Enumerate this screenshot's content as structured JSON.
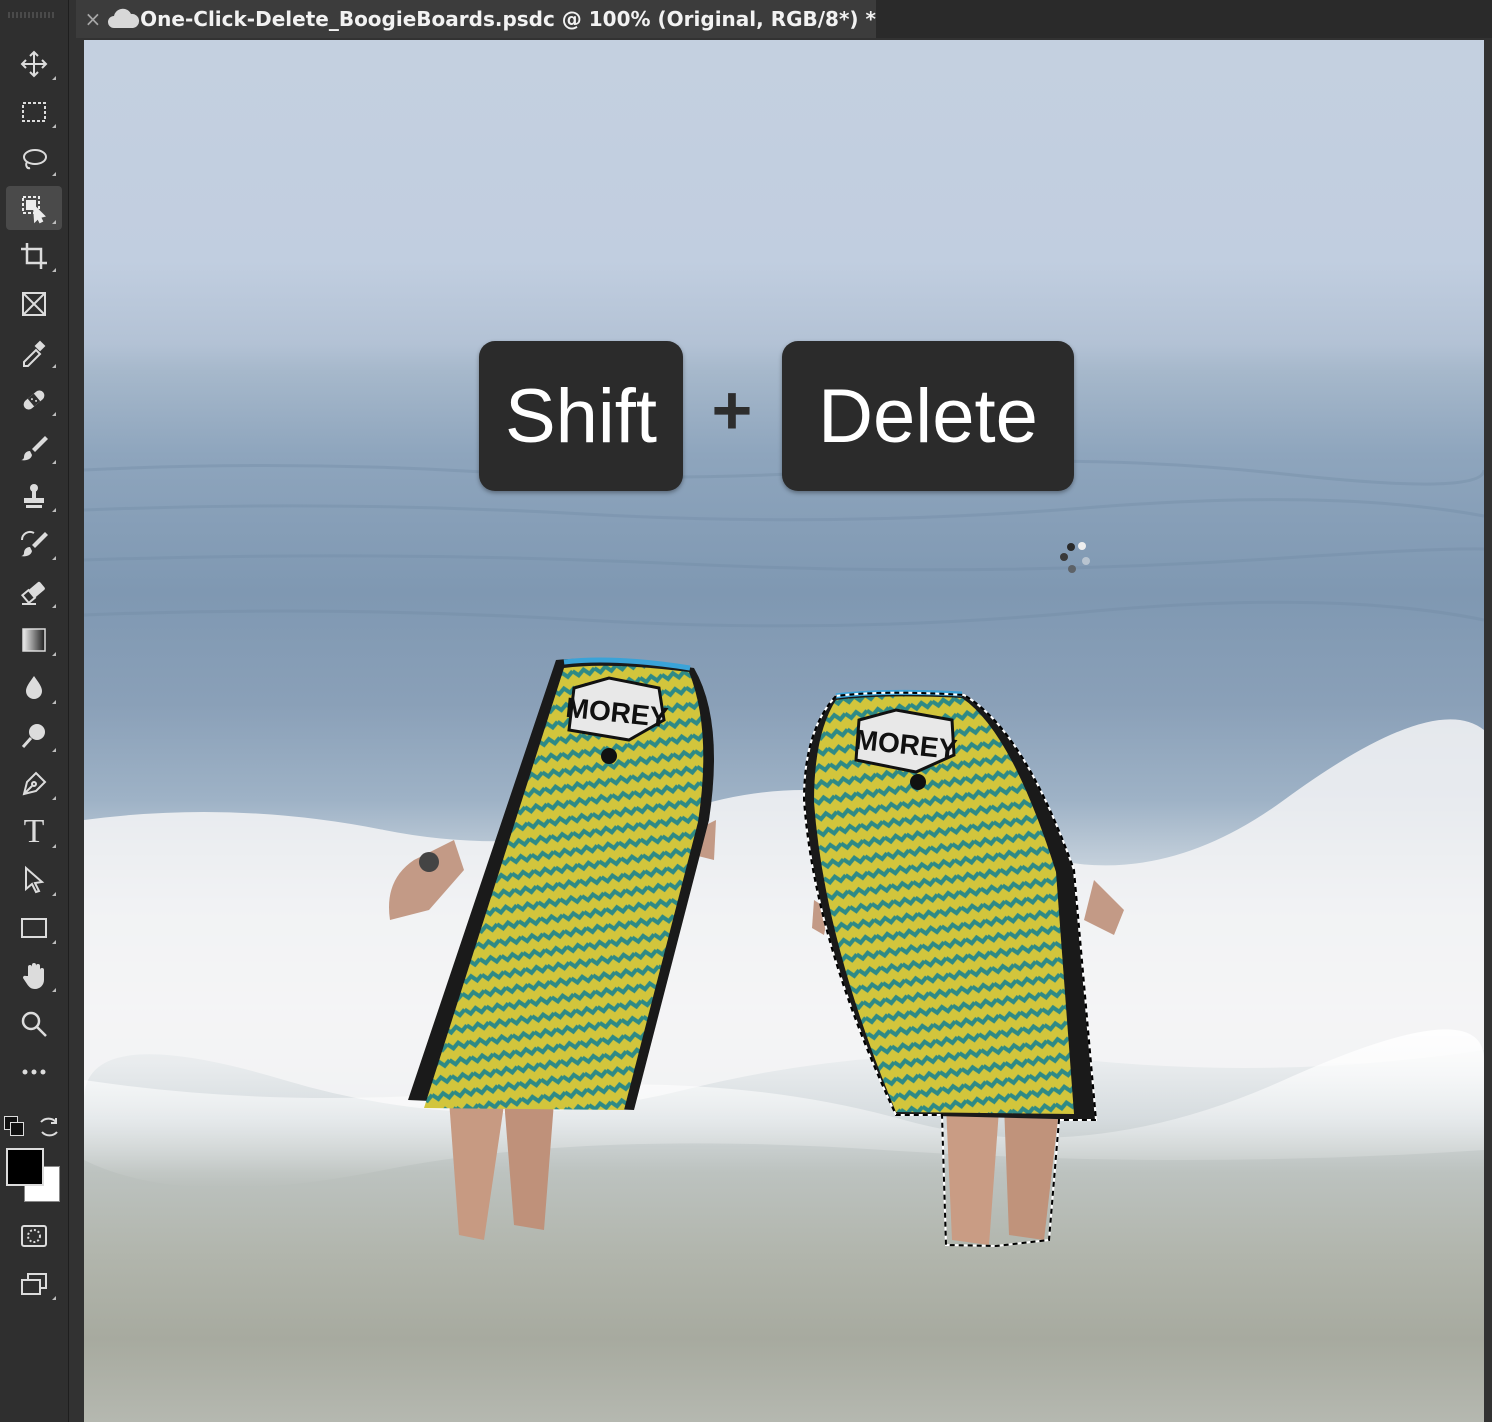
{
  "document_tab": {
    "close_glyph": "×",
    "title": "One-Click-Delete_BoogieBoards.psdc @ 100% (Original, RGB/8*) *"
  },
  "toolbar": {
    "tools": [
      {
        "name": "move-tool",
        "icon": "move-icon"
      },
      {
        "name": "rectangular-marquee-tool",
        "icon": "marquee-icon"
      },
      {
        "name": "lasso-tool",
        "icon": "lasso-icon"
      },
      {
        "name": "object-selection-tool",
        "icon": "object-selection-icon",
        "active": true
      },
      {
        "name": "crop-tool",
        "icon": "crop-icon"
      },
      {
        "name": "frame-tool",
        "icon": "frame-icon"
      },
      {
        "name": "eyedropper-tool",
        "icon": "eyedropper-icon"
      },
      {
        "name": "healing-brush-tool",
        "icon": "bandage-icon"
      },
      {
        "name": "brush-tool",
        "icon": "brush-icon"
      },
      {
        "name": "clone-stamp-tool",
        "icon": "stamp-icon"
      },
      {
        "name": "history-brush-tool",
        "icon": "history-brush-icon"
      },
      {
        "name": "eraser-tool",
        "icon": "eraser-icon"
      },
      {
        "name": "gradient-tool",
        "icon": "gradient-icon"
      },
      {
        "name": "blur-tool",
        "icon": "drop-icon"
      },
      {
        "name": "dodge-tool",
        "icon": "dodge-icon"
      },
      {
        "name": "pen-tool",
        "icon": "pen-icon"
      },
      {
        "name": "type-tool",
        "icon": "type-icon",
        "glyph": "T"
      },
      {
        "name": "path-selection-tool",
        "icon": "arrow-icon"
      },
      {
        "name": "rectangle-tool",
        "icon": "rectangle-icon"
      },
      {
        "name": "hand-tool",
        "icon": "hand-icon"
      },
      {
        "name": "zoom-tool",
        "icon": "zoom-icon"
      },
      {
        "name": "edit-toolbar",
        "icon": "more-icon"
      }
    ],
    "foreground_color": "#000000",
    "background_color": "#ffffff"
  },
  "overlay": {
    "key1": "Shift",
    "plus": "+",
    "key2": "Delete"
  },
  "canvas": {
    "board_logo_text": "MOREY",
    "board_colors": {
      "yellow": "#d4c93a",
      "teal": "#2a8c8c",
      "rail": "#1a1a1a",
      "top_rail": "#3aa3d8"
    }
  }
}
